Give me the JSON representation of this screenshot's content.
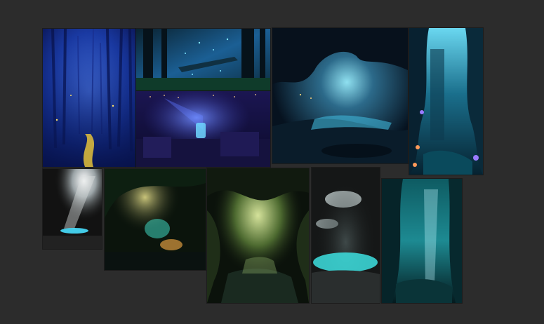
{
  "board": {
    "background": "#2c2c2c",
    "images": [
      {
        "id": "forest-path-blue",
        "palette": [
          "#0b1c6b",
          "#2a4fc8",
          "#e7c83a"
        ]
      },
      {
        "id": "forest-canopy-teal",
        "palette": [
          "#0a2a3a",
          "#1f6aa0",
          "#7fe7ff"
        ]
      },
      {
        "id": "cozy-room-violet",
        "palette": [
          "#12103a",
          "#3b2f8f",
          "#7fb0ff"
        ]
      },
      {
        "id": "cave-river-blue",
        "palette": [
          "#061428",
          "#1e4c6e",
          "#6fe6ff"
        ]
      },
      {
        "id": "underwater-cave-cyan",
        "palette": [
          "#041824",
          "#0f5f7a",
          "#7ee8ff"
        ]
      },
      {
        "id": "light-beam-cave",
        "palette": [
          "#141414",
          "#9aa3a6",
          "#49e0ff"
        ]
      },
      {
        "id": "glowing-grotto-green",
        "palette": [
          "#0a140c",
          "#2f6b3a",
          "#ffb14a"
        ]
      },
      {
        "id": "mossy-cave-stream",
        "palette": [
          "#0b120b",
          "#3f5a2b",
          "#b9d27a"
        ]
      },
      {
        "id": "hot-spring-cave",
        "palette": [
          "#121414",
          "#4b5454",
          "#3de0e0"
        ]
      },
      {
        "id": "submerged-cave-teal",
        "palette": [
          "#03161a",
          "#0e5b62",
          "#8ff2ff"
        ]
      }
    ]
  }
}
